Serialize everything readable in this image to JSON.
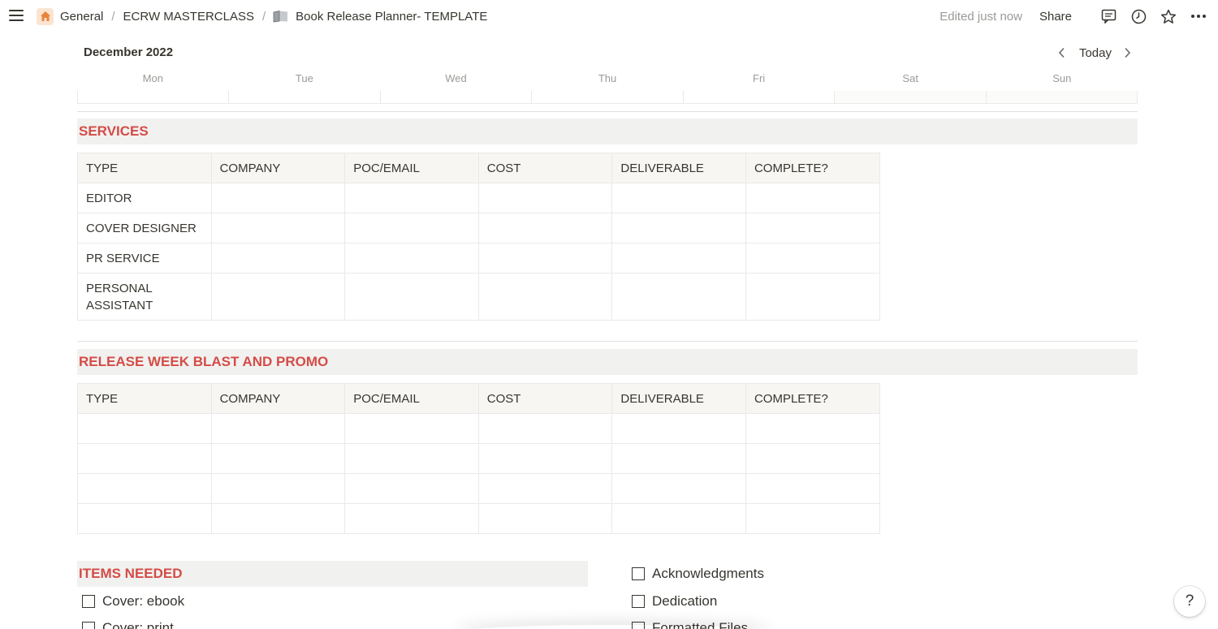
{
  "topbar": {
    "breadcrumbs": [
      "General",
      "ECRW MASTERCLASS",
      "Book Release Planner- TEMPLATE"
    ],
    "separator": "/",
    "edited": "Edited just now",
    "share": "Share",
    "icons": [
      "menu-icon",
      "home-icon",
      "folder-icon",
      "comment-icon",
      "history-icon",
      "star-icon",
      "more-icon"
    ]
  },
  "calendar": {
    "month": "December 2022",
    "today": "Today",
    "days": [
      "Mon",
      "Tue",
      "Wed",
      "Thu",
      "Fri",
      "Sat",
      "Sun"
    ]
  },
  "services": {
    "title": "SERVICES",
    "headers": [
      "TYPE",
      "COMPANY",
      "POC/EMAIL",
      "COST",
      "DELIVERABLE",
      "COMPLETE?"
    ],
    "rows": [
      [
        "EDITOR",
        "",
        "",
        "",
        "",
        ""
      ],
      [
        "COVER DESIGNER",
        "",
        "",
        "",
        "",
        ""
      ],
      [
        "PR SERVICE",
        "",
        "",
        "",
        "",
        ""
      ],
      [
        "PERSONAL ASSISTANT",
        "",
        "",
        "",
        "",
        ""
      ]
    ]
  },
  "release": {
    "title": "RELEASE WEEK BLAST AND PROMO",
    "headers": [
      "TYPE",
      "COMPANY",
      "POC/EMAIL",
      "COST",
      "DELIVERABLE",
      "COMPLETE?"
    ],
    "rows": [
      [
        "",
        "",
        "",
        "",
        "",
        ""
      ],
      [
        "",
        "",
        "",
        "",
        "",
        ""
      ],
      [
        "",
        "",
        "",
        "",
        "",
        ""
      ],
      [
        "",
        "",
        "",
        "",
        "",
        ""
      ]
    ]
  },
  "items": {
    "title": "ITEMS NEEDED",
    "left": [
      "Cover: ebook",
      "Cover: print"
    ],
    "right": [
      "Acknowledgments",
      "Dedication",
      "Formatted Files"
    ]
  },
  "help": "?",
  "colors": {
    "accent_red": "#d44c47",
    "section_bg": "#f1f1ef",
    "text": "#37352f",
    "muted": "#9b9a97"
  }
}
